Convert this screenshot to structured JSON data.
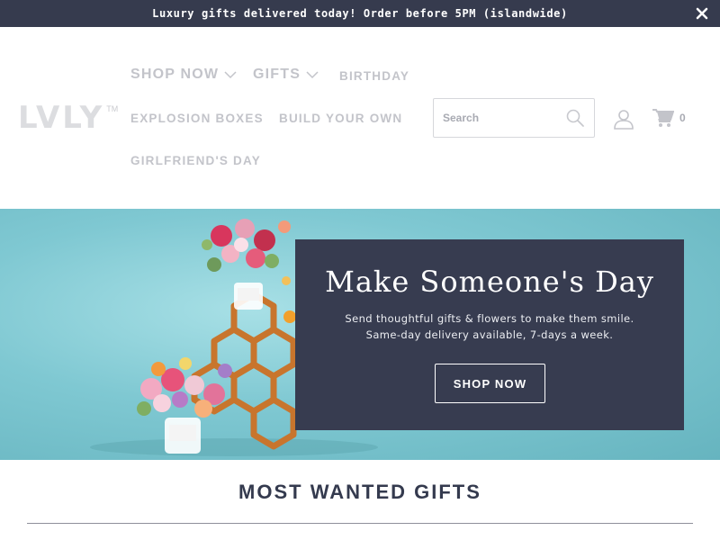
{
  "announcement": {
    "text": "Luxury gifts delivered today! Order before 5PM (islandwide)",
    "close_icon": "close-icon"
  },
  "header": {
    "logo": "LVLY",
    "logo_tm": "TM",
    "nav": {
      "shop_now": "SHOP NOW",
      "gifts": "GIFTS",
      "birthday": "BIRTHDAY",
      "explosion_boxes": "EXPLOSION BOXES",
      "build_your_own": "BUILD YOUR OWN",
      "girlfriends_day": "GIRLFRIEND'S DAY"
    },
    "search": {
      "placeholder": "Search",
      "icon": "search-icon"
    },
    "account_icon": "user-icon",
    "cart": {
      "icon": "cart-icon",
      "count": "0"
    }
  },
  "hero": {
    "title": "Make Someone's Day",
    "line1": "Send thoughtful gifts & flowers to make them smile.",
    "line2": "Same-day delivery available, 7-days a week.",
    "button": "SHOP NOW"
  },
  "section": {
    "title": "MOST WANTED GIFTS"
  },
  "colors": {
    "announce_bg": "#363b4e",
    "hero_box": "#373c50",
    "hero_bg": "#7fc8d2",
    "nav_text": "#c3c4ca"
  }
}
